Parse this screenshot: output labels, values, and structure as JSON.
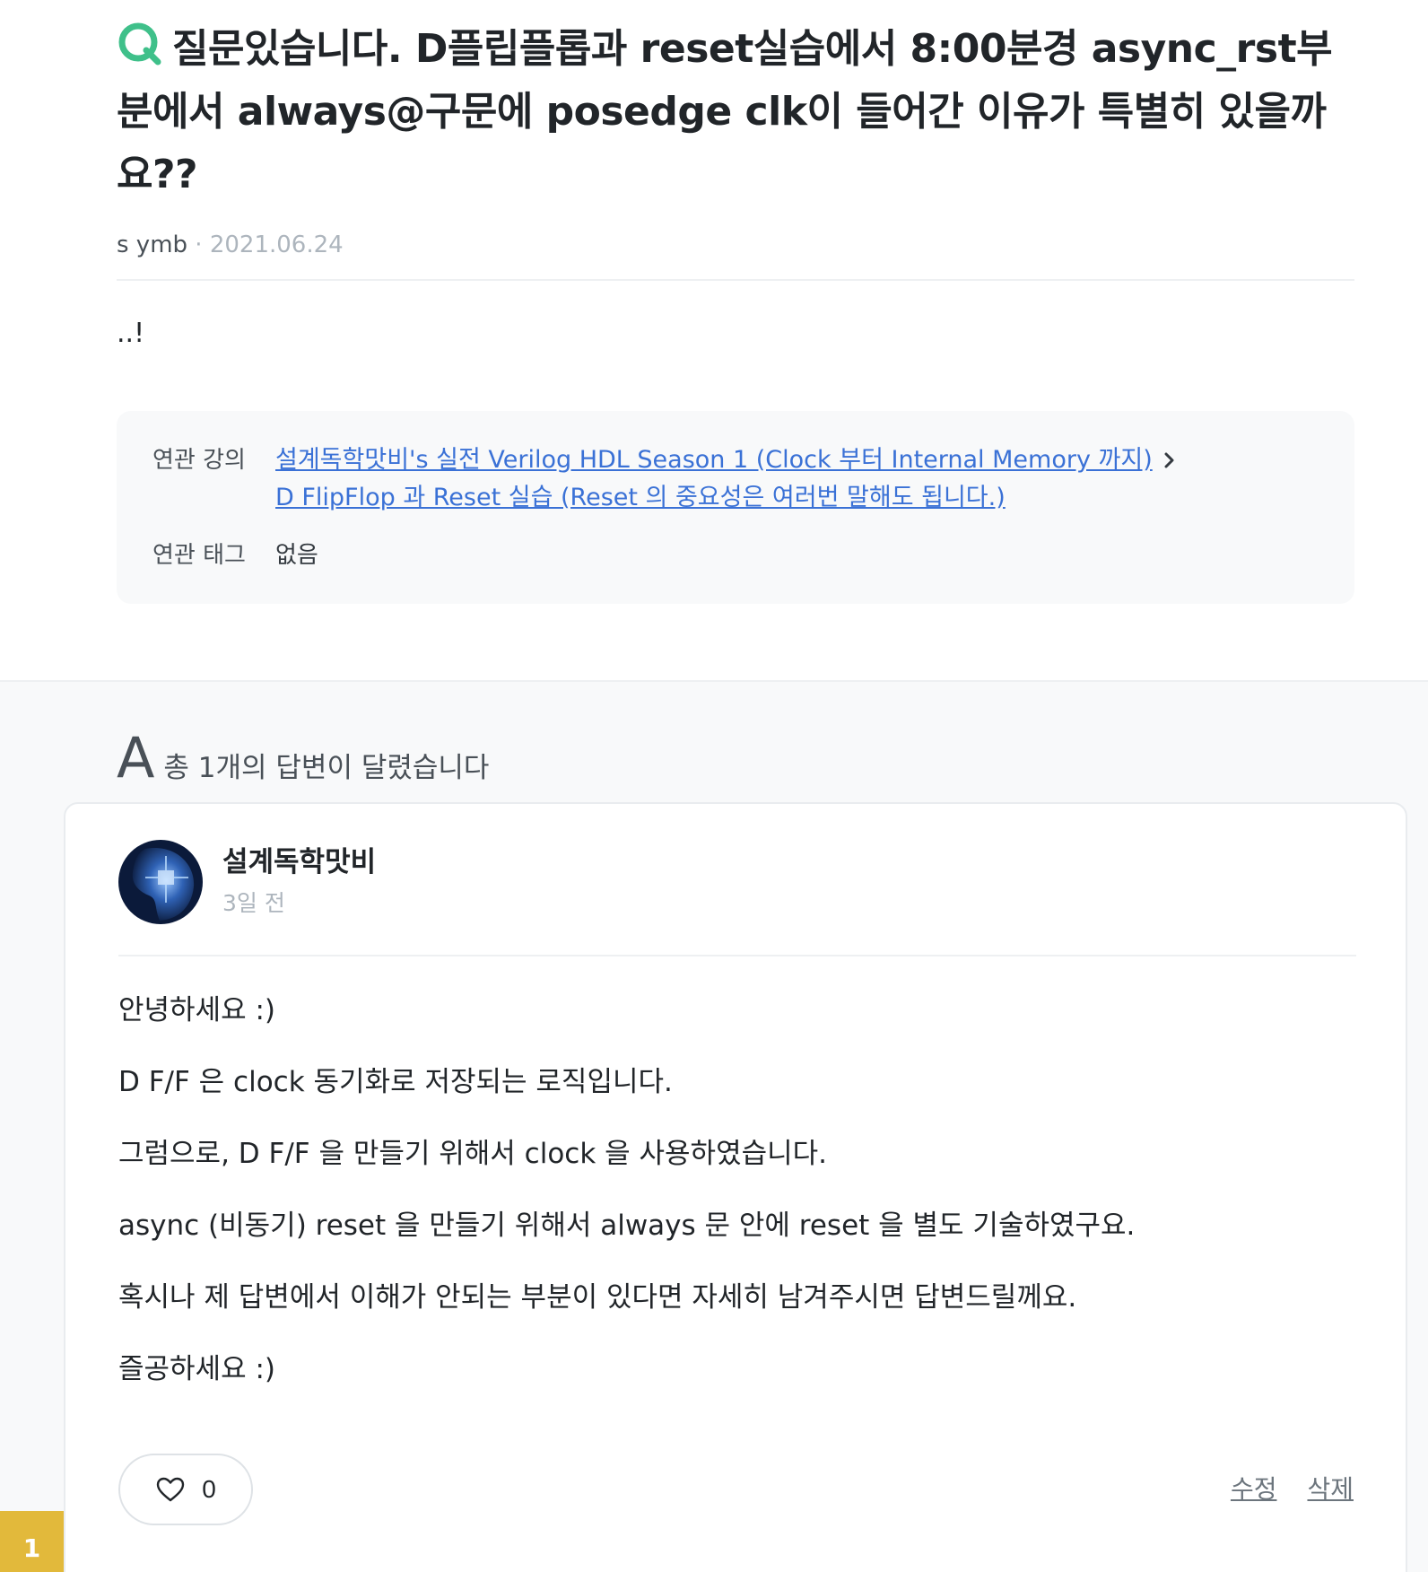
{
  "question": {
    "title": "질문있습니다. D플립플롭과 reset실습에서 8:00분경 async_rst부분에서 always@구문에 posedge clk이 들어간 이유가 특별히 있을까요??",
    "author": "s ymb",
    "separator": "·",
    "date": "2021.06.24",
    "body": "..!",
    "icon": "q-mark-icon",
    "accent_color": "#3fc08a"
  },
  "related": {
    "course_label": "연관 강의",
    "course_link": "설계독학맛비's 실전 Verilog HDL Season 1 (Clock 부터 Internal Memory 까지)",
    "lesson_link": "D FlipFlop 과 Reset 실습 (Reset 의 중요성은 여러번 말해도 됩니다.)",
    "tags_label": "연관 태그",
    "tags_value": "없음",
    "link_color": "#3a71d6"
  },
  "answers": {
    "heading_letter": "A",
    "heading_text": "총 1개의 답변이 달렸습니다",
    "items": [
      {
        "index": "1",
        "index_color": "#e2b93b",
        "author": "설계독학맛비",
        "time": "3일 전",
        "paragraphs": [
          "안녕하세요 :)",
          "D F/F 은 clock 동기화로 저장되는 로직입니다.",
          "그럼으로, D F/F 을 만들기 위해서 clock 을 사용하였습니다.",
          "async (비동기) reset 을 만들기 위해서 always 문 안에 reset 을 별도 기술하였구요.",
          "혹시나 제 답변에서 이해가 안되는 부분이 있다면 자세히 남겨주시면 답변드릴께요.",
          "즐공하세요 :)"
        ],
        "likes": "0",
        "edit_label": "수정",
        "delete_label": "삭제"
      }
    ]
  }
}
